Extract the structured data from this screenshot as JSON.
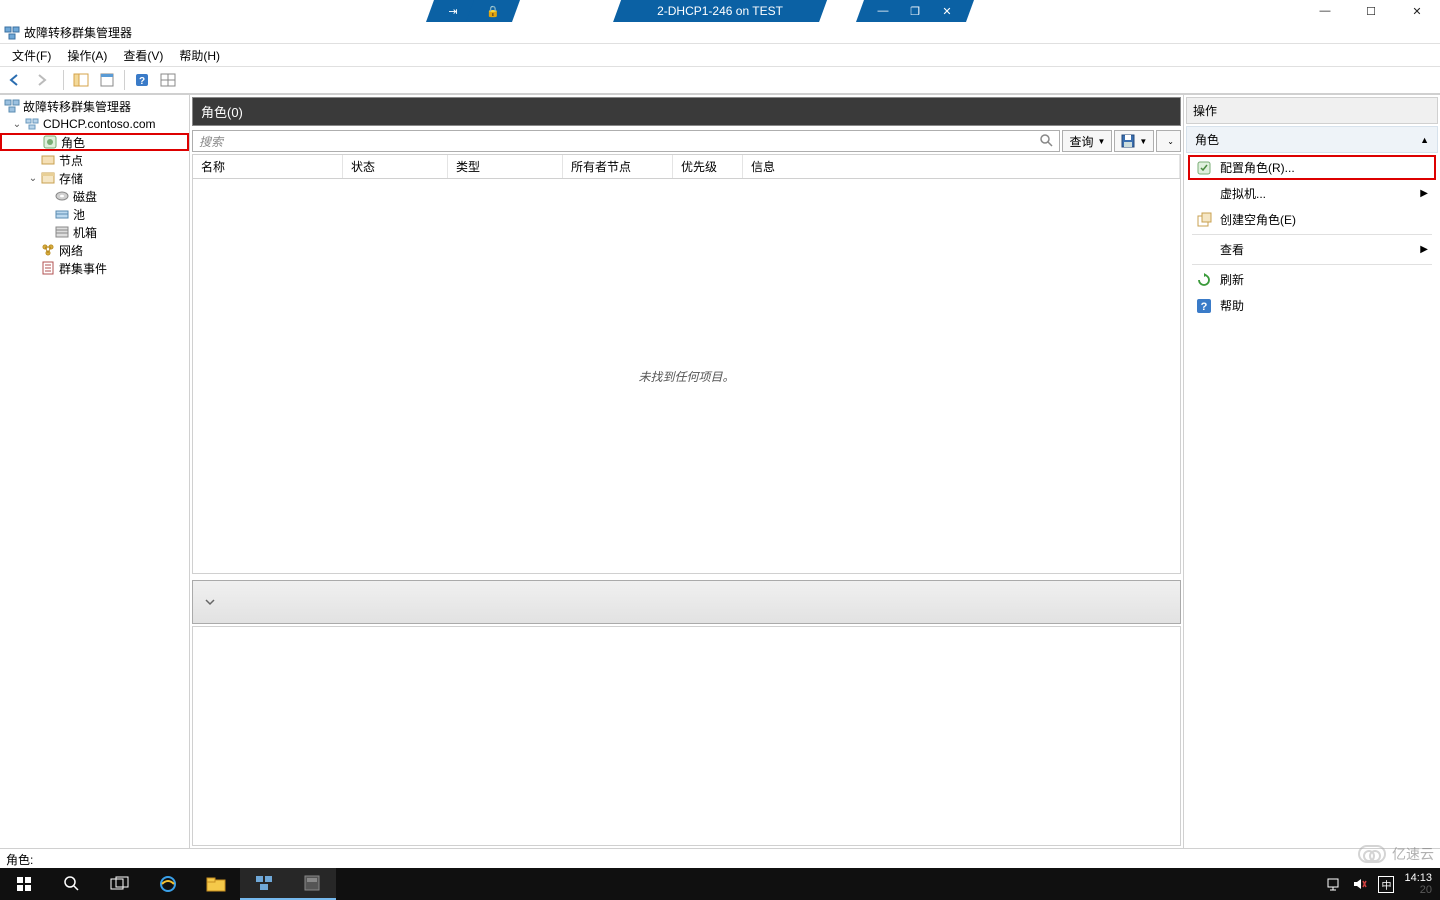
{
  "vm": {
    "title": "2-DHCP1-246 on TEST",
    "pin": "📌",
    "lock": "🔒"
  },
  "app": {
    "title": "故障转移群集管理器"
  },
  "menu": {
    "file": "文件(F)",
    "action": "操作(A)",
    "view": "查看(V)",
    "help": "帮助(H)"
  },
  "tree": {
    "root": "故障转移群集管理器",
    "cluster": "CDHCP.contoso.com",
    "roles": "角色",
    "nodes": "节点",
    "storage": "存储",
    "disks": "磁盘",
    "pools": "池",
    "enclosures": "机箱",
    "networks": "网络",
    "events": "群集事件"
  },
  "center": {
    "header": "角色(0)",
    "search_placeholder": "搜索",
    "query_btn": "查询",
    "no_items": "未找到任何项目。",
    "columns": {
      "name": "名称",
      "status": "状态",
      "type": "类型",
      "owner": "所有者节点",
      "priority": "优先级",
      "info": "信息"
    }
  },
  "actions": {
    "title": "操作",
    "sub": "角色",
    "configure": "配置角色(R)...",
    "vm": "虚拟机...",
    "create_empty": "创建空角色(E)",
    "view": "查看",
    "refresh": "刷新",
    "help": "帮助"
  },
  "status": {
    "label": "角色:"
  },
  "taskbar": {
    "time": "14:13",
    "date": "20",
    "ime": "中"
  },
  "watermark": "亿速云"
}
